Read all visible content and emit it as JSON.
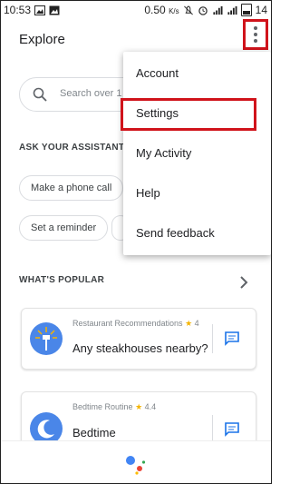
{
  "status_bar": {
    "time": "10:53",
    "network_speed": "0.50",
    "network_unit": "K/s",
    "battery": "14"
  },
  "header": {
    "title": "Explore"
  },
  "search": {
    "placeholder": "Search over 1"
  },
  "ask_section": {
    "title": "ASK YOUR ASSISTANT",
    "chips": [
      "Make a phone call",
      "Set a reminder"
    ]
  },
  "popular_section": {
    "title": "WHAT'S POPULAR"
  },
  "cards": [
    {
      "category": "Restaurant Recommendations",
      "rating": "4",
      "title": "Any steakhouses nearby?",
      "icon": "fork-knife-icon"
    },
    {
      "category": "Bedtime Routine",
      "rating": "4.4",
      "title": "Bedtime",
      "icon": "moon-icon"
    }
  ],
  "menu": {
    "items": [
      "Account",
      "Settings",
      "My Activity",
      "Help",
      "Send feedback"
    ]
  },
  "colors": {
    "highlight_red": "#d0131b",
    "card_icon_blue": "#4a86e8",
    "star_yellow": "#f4b400",
    "action_blue": "#1a73e8"
  }
}
